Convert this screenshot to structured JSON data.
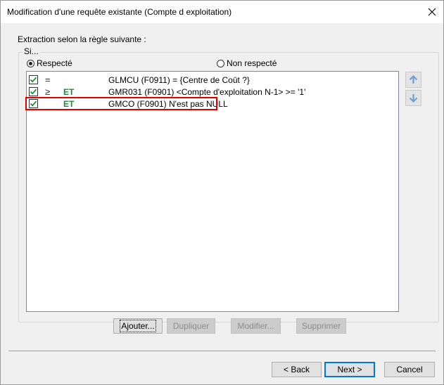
{
  "window": {
    "title": "Modification d'une requête existante (Compte d exploitation)",
    "close_label": "×"
  },
  "rule_label": "Extraction selon la règle suivante :",
  "group_caption": "Si...",
  "radios": {
    "respected": {
      "label": "Respecté",
      "checked": true
    },
    "not_respected": {
      "label": "Non respecté",
      "checked": false
    }
  },
  "conditions": [
    {
      "checked": true,
      "operator": "=",
      "conjunction": "",
      "text": "GLMCU (F0911) = {Centre de Coût ?}"
    },
    {
      "checked": true,
      "operator": "≥",
      "conjunction": "ET",
      "text": "GMR031 (F0901) <Compte d'exploitation N-1> >= '1'"
    },
    {
      "checked": true,
      "operator": "",
      "conjunction": "ET",
      "text": "GMCO (F0901) N'est pas NULL"
    }
  ],
  "move_buttons": {
    "up_icon": "arrow-up-icon",
    "down_icon": "arrow-down-icon"
  },
  "action_buttons": {
    "add": "Ajouter...",
    "duplicate": "Dupliquer",
    "modify": "Modifier...",
    "delete": "Supprimer"
  },
  "footer_buttons": {
    "back": "< Back",
    "next": "Next >",
    "cancel": "Cancel"
  },
  "colors": {
    "conjunction": "#1e8a3a",
    "checkbox_tick": "#1e8a3a",
    "highlight_border": "#e00000",
    "arrow": "#6f9fcf"
  }
}
